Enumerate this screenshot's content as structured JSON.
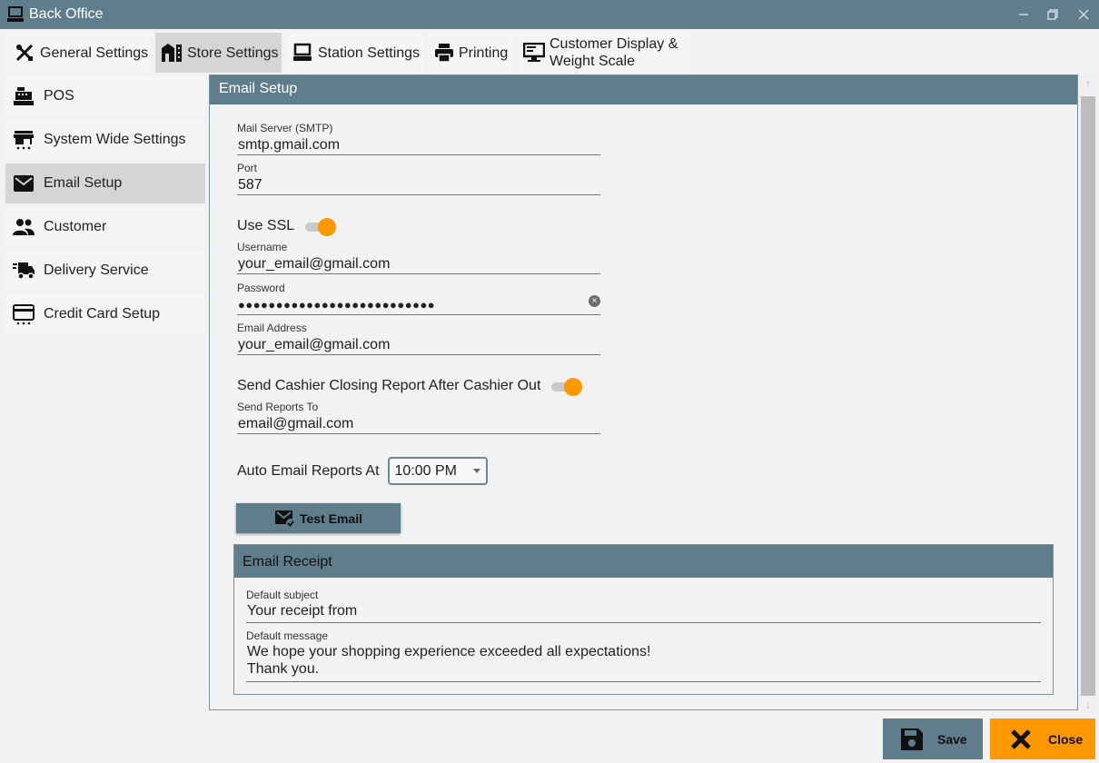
{
  "window": {
    "title": "Back Office",
    "icon": "computer-icon",
    "controls": [
      "minimize-icon",
      "restore-icon",
      "close-icon"
    ]
  },
  "tabs": [
    {
      "label": "General Settings",
      "icon": "tools-icon",
      "active": false
    },
    {
      "label": "Store Settings",
      "icon": "store-icon",
      "active": true
    },
    {
      "label": "Station Settings",
      "icon": "computer-icon",
      "active": false
    },
    {
      "label": "Printing",
      "icon": "printer-icon",
      "active": false
    },
    {
      "label": "Customer Display & Weight Scale",
      "line1": "Customer Display &",
      "line2": "Weight Scale",
      "icon": "monitor-scale-icon",
      "active": false
    }
  ],
  "sidebar": {
    "items": [
      {
        "label": "POS",
        "icon": "cash-register-icon",
        "active": false
      },
      {
        "label": "System Wide Settings",
        "icon": "store-network-icon",
        "active": false
      },
      {
        "label": "Email Setup",
        "icon": "envelope-icon",
        "active": true
      },
      {
        "label": "Customer",
        "icon": "people-icon",
        "active": false
      },
      {
        "label": "Delivery Service",
        "icon": "truck-icon",
        "active": false
      },
      {
        "label": "Credit Card Setup",
        "icon": "credit-card-icon",
        "active": false
      }
    ]
  },
  "email_setup": {
    "header": "Email Setup",
    "mail_server": {
      "label": "Mail Server (SMTP)",
      "value": "smtp.gmail.com"
    },
    "port": {
      "label": "Port",
      "value": "587"
    },
    "use_ssl": {
      "label": "Use SSL",
      "on": true
    },
    "username": {
      "label": "Username",
      "value": "your_email@gmail.com"
    },
    "password": {
      "label": "Password",
      "value": "●●●●●●●●●●●●●●●●●●●●●●●●●●"
    },
    "email_address": {
      "label": "Email Address",
      "value": "your_email@gmail.com"
    },
    "send_closing_report": {
      "label": "Send Cashier Closing Report After Cashier Out",
      "on": true
    },
    "send_reports_to": {
      "label": "Send Reports To",
      "value": "email@gmail.com"
    },
    "auto_email": {
      "label": "Auto Email Reports At",
      "value": "10:00 PM"
    },
    "test_button": "Test Email"
  },
  "email_receipt": {
    "header": "Email Receipt",
    "subject": {
      "label": "Default subject",
      "value": "Your receipt from"
    },
    "message": {
      "label": "Default message",
      "line1": "We hope your shopping experience exceeded all expectations!",
      "line2": "Thank you."
    }
  },
  "buttons": {
    "save": "Save",
    "close": "Close"
  },
  "colors": {
    "primary": "#607d8b",
    "accent": "#ff9800",
    "active_tab": "#d5d5d5"
  }
}
